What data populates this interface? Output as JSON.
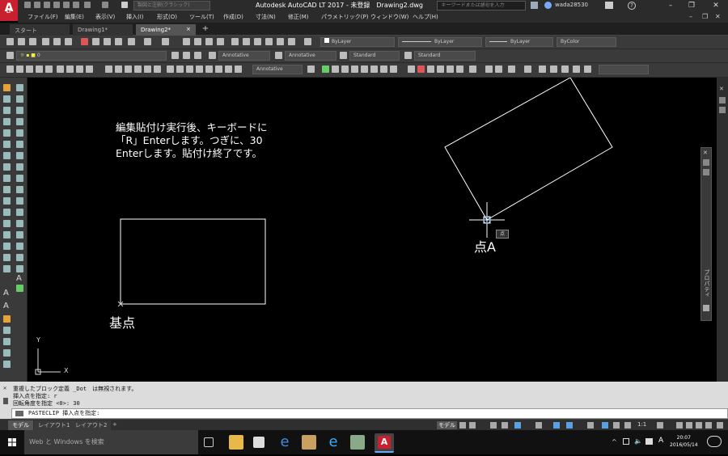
{
  "app": {
    "logo_text": "A",
    "logo_sub": "LT",
    "workspace": "製図と注釈(クラシック)",
    "title": "Autodesk AutoCAD LT 2017 - 未登録　Drawing2.dwg",
    "search_placeholder": "キーワードまたは語句を入力",
    "user": "wada28530",
    "win_min": "–",
    "win_restore": "❐",
    "win_close": "✕"
  },
  "menu": [
    "ファイル(F)",
    "編集(E)",
    "表示(V)",
    "挿入(I)",
    "形式(O)",
    "ツール(T)",
    "作成(D)",
    "寸法(N)",
    "修正(M)",
    "パラメトリック(P)",
    "ウィンドウ(W)",
    "ヘルプ(H)"
  ],
  "doc_tabs": {
    "start": "スタート",
    "drawing1": "Drawing1*",
    "drawing2": "Drawing2*",
    "close": "×",
    "add": "+"
  },
  "props": {
    "layer_color": "ByLayer",
    "linetype": "ByLayer",
    "lineweight": "ByLayer",
    "plot": "ByColor"
  },
  "styles": {
    "layer": "0",
    "text_style": "Annotative",
    "dim_style": "Annotative",
    "table_style": "Standard",
    "mleader_style": "Standard",
    "annot_scale": "Annotative"
  },
  "canvas": {
    "note_lines": [
      "編集貼付け実行後、キーボードに",
      "「R」Enterします。つぎに、30",
      "Enterします。貼付け終了です。"
    ],
    "base_label": "基点",
    "point_label": "点A",
    "snap_tooltip": "点",
    "ucs_y": "Y",
    "ucs_x": "X"
  },
  "right_panel": {
    "title": "プロパティ"
  },
  "command": {
    "history": [
      "重複したブロック定義 _Dot　は無視されます。",
      "挿入点を指定: r",
      "回転角度を指定 <0>: 30"
    ],
    "prompt": "PASTECLIP 挿入点を指定:"
  },
  "layout_tabs": {
    "model": "モデル",
    "layout1": "レイアウト1",
    "layout2": "レイアウト2",
    "add": "+"
  },
  "status": {
    "model_label": "モデル",
    "scale": "1:1"
  },
  "taskbar": {
    "search": "Web と Windows を検索",
    "ime": "A",
    "time": "20:07",
    "date": "2016/05/14"
  }
}
